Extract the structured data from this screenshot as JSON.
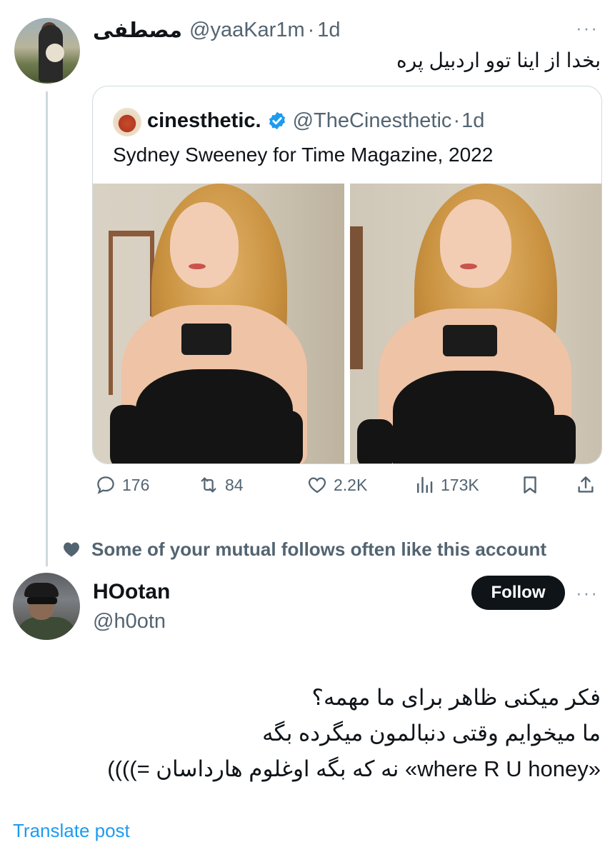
{
  "tweet1": {
    "name": "مصطفى",
    "handle": "@yaaKar1m",
    "dot": "·",
    "time": "1d",
    "text": "بخدا از اینا توو اردبیل پره",
    "more": "···"
  },
  "quote": {
    "name": "cinesthetic.",
    "handle": "@TheCinesthetic",
    "dot": "·",
    "time": "1d",
    "text": "Sydney Sweeney for Time Magazine, 2022",
    "verified_color": "#1d9bf0"
  },
  "actions": {
    "replies": "176",
    "reposts": "84",
    "likes": "2.2K",
    "views": "173K"
  },
  "social_context": {
    "text": "Some of your mutual follows often like this account"
  },
  "tweet2": {
    "name": "HOotan",
    "handle": "@h0otn",
    "follow_label": "Follow",
    "more": "···",
    "lines": [
      "فکر میکنی ظاهر برای ما مهمه؟",
      "ما میخوایم وقتی دنبالمون میگرده بگه",
      "«where R U honey» نه که بگه اوغلوم هارداسان =))))"
    ]
  },
  "translate_label": "Translate post",
  "colors": {
    "text": "#0f1419",
    "secondary": "#536471",
    "accent": "#1d9bf0",
    "border": "#cfd9de"
  }
}
